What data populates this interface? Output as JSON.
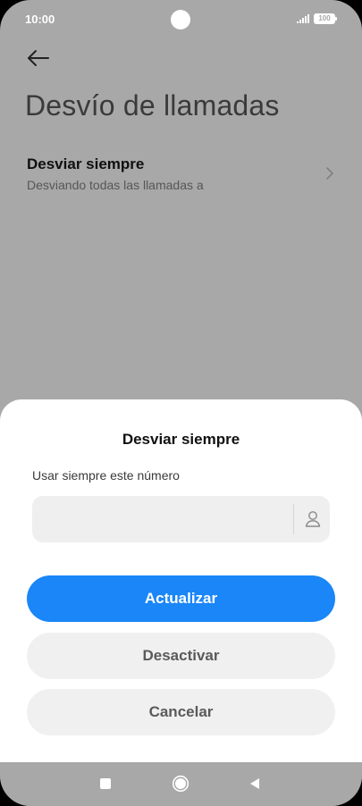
{
  "status_bar": {
    "time": "10:00",
    "battery": "100"
  },
  "page": {
    "title": "Desvío de llamadas",
    "setting_item": {
      "title": "Desviar siempre",
      "subtitle": "Desviando todas las llamadas a"
    }
  },
  "dialog": {
    "title": "Desviar siempre",
    "field_label": "Usar siempre este número",
    "number_value": "",
    "buttons": {
      "update": "Actualizar",
      "deactivate": "Desactivar",
      "cancel": "Cancelar"
    }
  },
  "colors": {
    "primary": "#1a86f8",
    "scrim": "#a8a8a8",
    "secondary_button": "#f0f0f0"
  },
  "icons": {
    "back": "arrow-left-icon",
    "chevron": "chevron-right-icon",
    "contact": "person-icon",
    "nav_recents": "square-icon",
    "nav_home": "circle-icon",
    "nav_back": "triangle-icon"
  }
}
